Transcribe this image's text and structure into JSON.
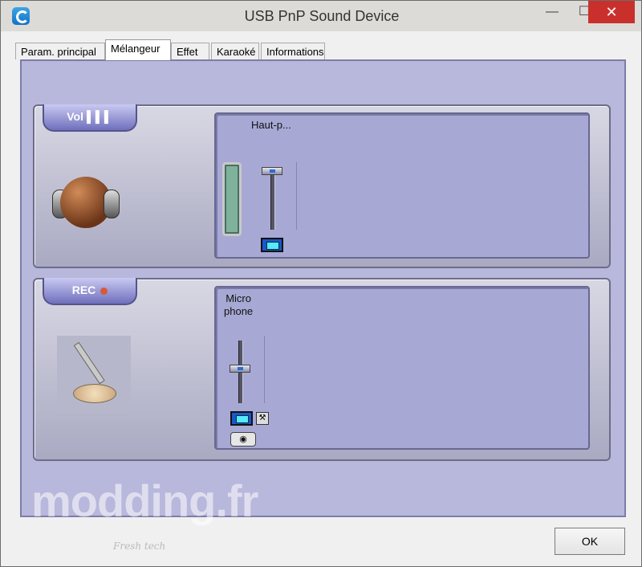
{
  "window": {
    "title": "USB PnP Sound Device"
  },
  "titlebar": {
    "minimize": "—",
    "maximize": "☐",
    "close": "✕"
  },
  "tabs": [
    {
      "label": "Param. principal"
    },
    {
      "label": "Mélangeur",
      "selected": true
    },
    {
      "label": "Effet"
    },
    {
      "label": "Karaoké"
    },
    {
      "label": "Informations"
    }
  ],
  "playback_panel": {
    "tab_label": "Vol",
    "channel_label": "Haut-p..."
  },
  "record_panel": {
    "tab_label": "REC",
    "channel_label_line1": "Micro",
    "channel_label_line2": "phone"
  },
  "footer": {
    "ok_label": "OK"
  },
  "watermark": {
    "main": "modding.fr",
    "sub": "Fresh tech"
  },
  "colors": {
    "content_bg": "#b8b7dc",
    "tab_label_bg": "#6f6fbd",
    "close_btn": "#c9302c"
  }
}
